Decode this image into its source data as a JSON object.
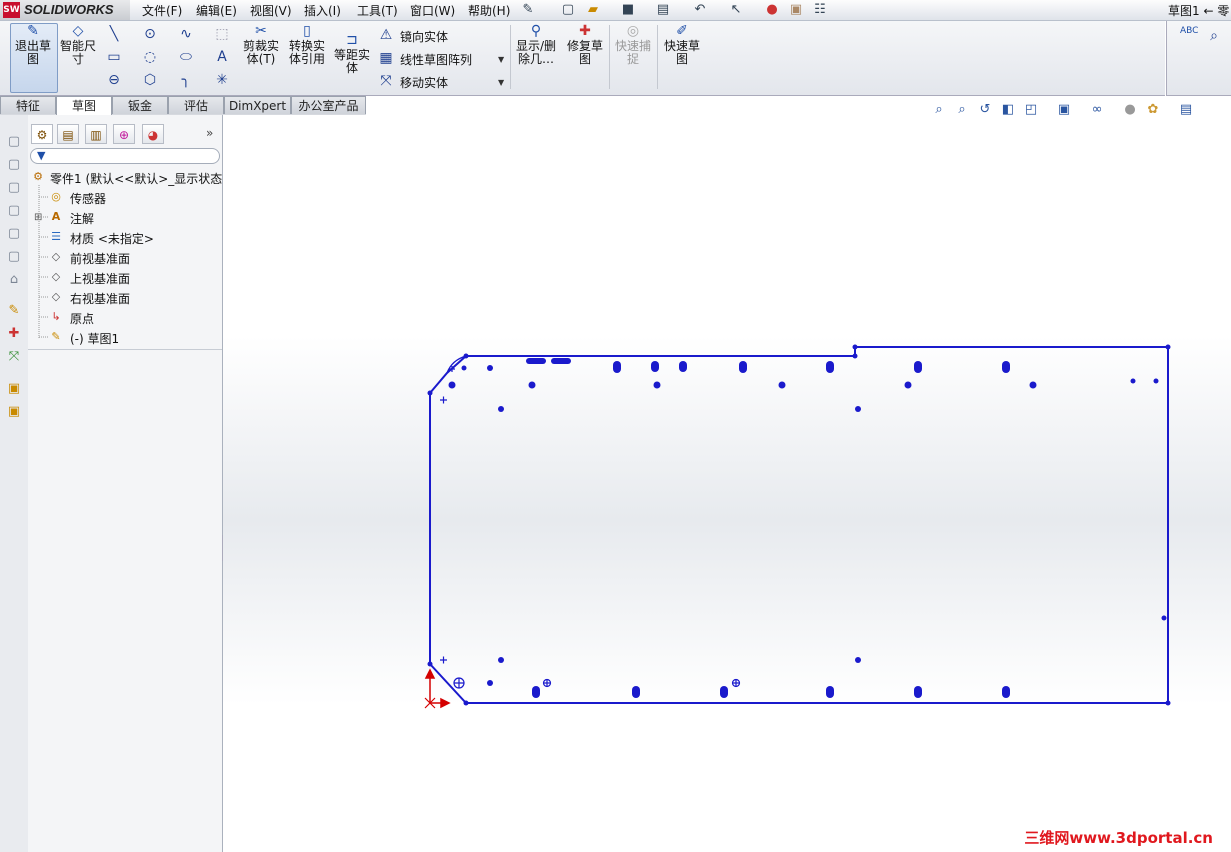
{
  "app": {
    "logo_text": "SOLIDWORKS",
    "doc_title": "草图1 ← 零"
  },
  "menu": [
    "文件(F)",
    "编辑(E)",
    "视图(V)",
    "插入(I)",
    "工具(T)",
    "窗口(W)",
    "帮助(H)"
  ],
  "commands": {
    "exit_sketch": "退出草图",
    "smart_dim": "智能尺寸",
    "trim": "剪裁实体(T)",
    "convert": "转换实体引用",
    "offset": "等距实体",
    "mirror": "镜向实体",
    "linear_pattern": "线性草图阵列",
    "move": "移动实体",
    "show_delete": "显示/删除几…",
    "repair": "修复草图",
    "quick_snap": "快速捕捉",
    "rapid_sketch": "快速草图",
    "abc": "ABC"
  },
  "tabs": [
    "特征",
    "草图",
    "钣金",
    "评估",
    "DimXpert",
    "办公室产品"
  ],
  "active_tab": "草图",
  "tree": {
    "root": "零件1  (默认<<默认>_显示状态",
    "items": [
      "传感器",
      "注解",
      "材质 <未指定>",
      "前视基准面",
      "上视基准面",
      "右视基准面",
      "原点",
      "(-) 草图1"
    ]
  },
  "watermark": "三维网www.3dportal.cn",
  "colors": {
    "sketch": "#1a1acc",
    "origin": "#d40000",
    "accent": "#1f4fa8"
  }
}
